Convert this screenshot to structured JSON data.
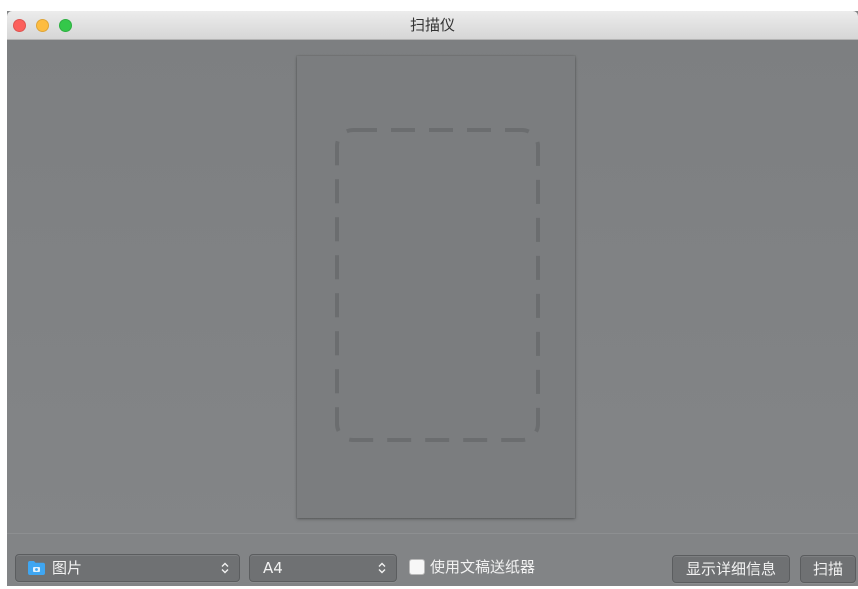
{
  "window": {
    "title": "扫描仪",
    "controls": {
      "close": "#fc605c",
      "minimize": "#fdbc40",
      "zoom": "#34c84a"
    }
  },
  "toolbar": {
    "destination": {
      "label": "图片",
      "icon": "pictures-folder-icon",
      "icon_color": "#3fa6f2"
    },
    "paper_size": {
      "label": "A4",
      "icon": "popup-arrows-icon"
    },
    "feeder": {
      "label": "使用文稿送纸器",
      "checked": false
    },
    "details_button": {
      "label": "显示详细信息"
    },
    "scan_button": {
      "label": "扫描"
    }
  }
}
